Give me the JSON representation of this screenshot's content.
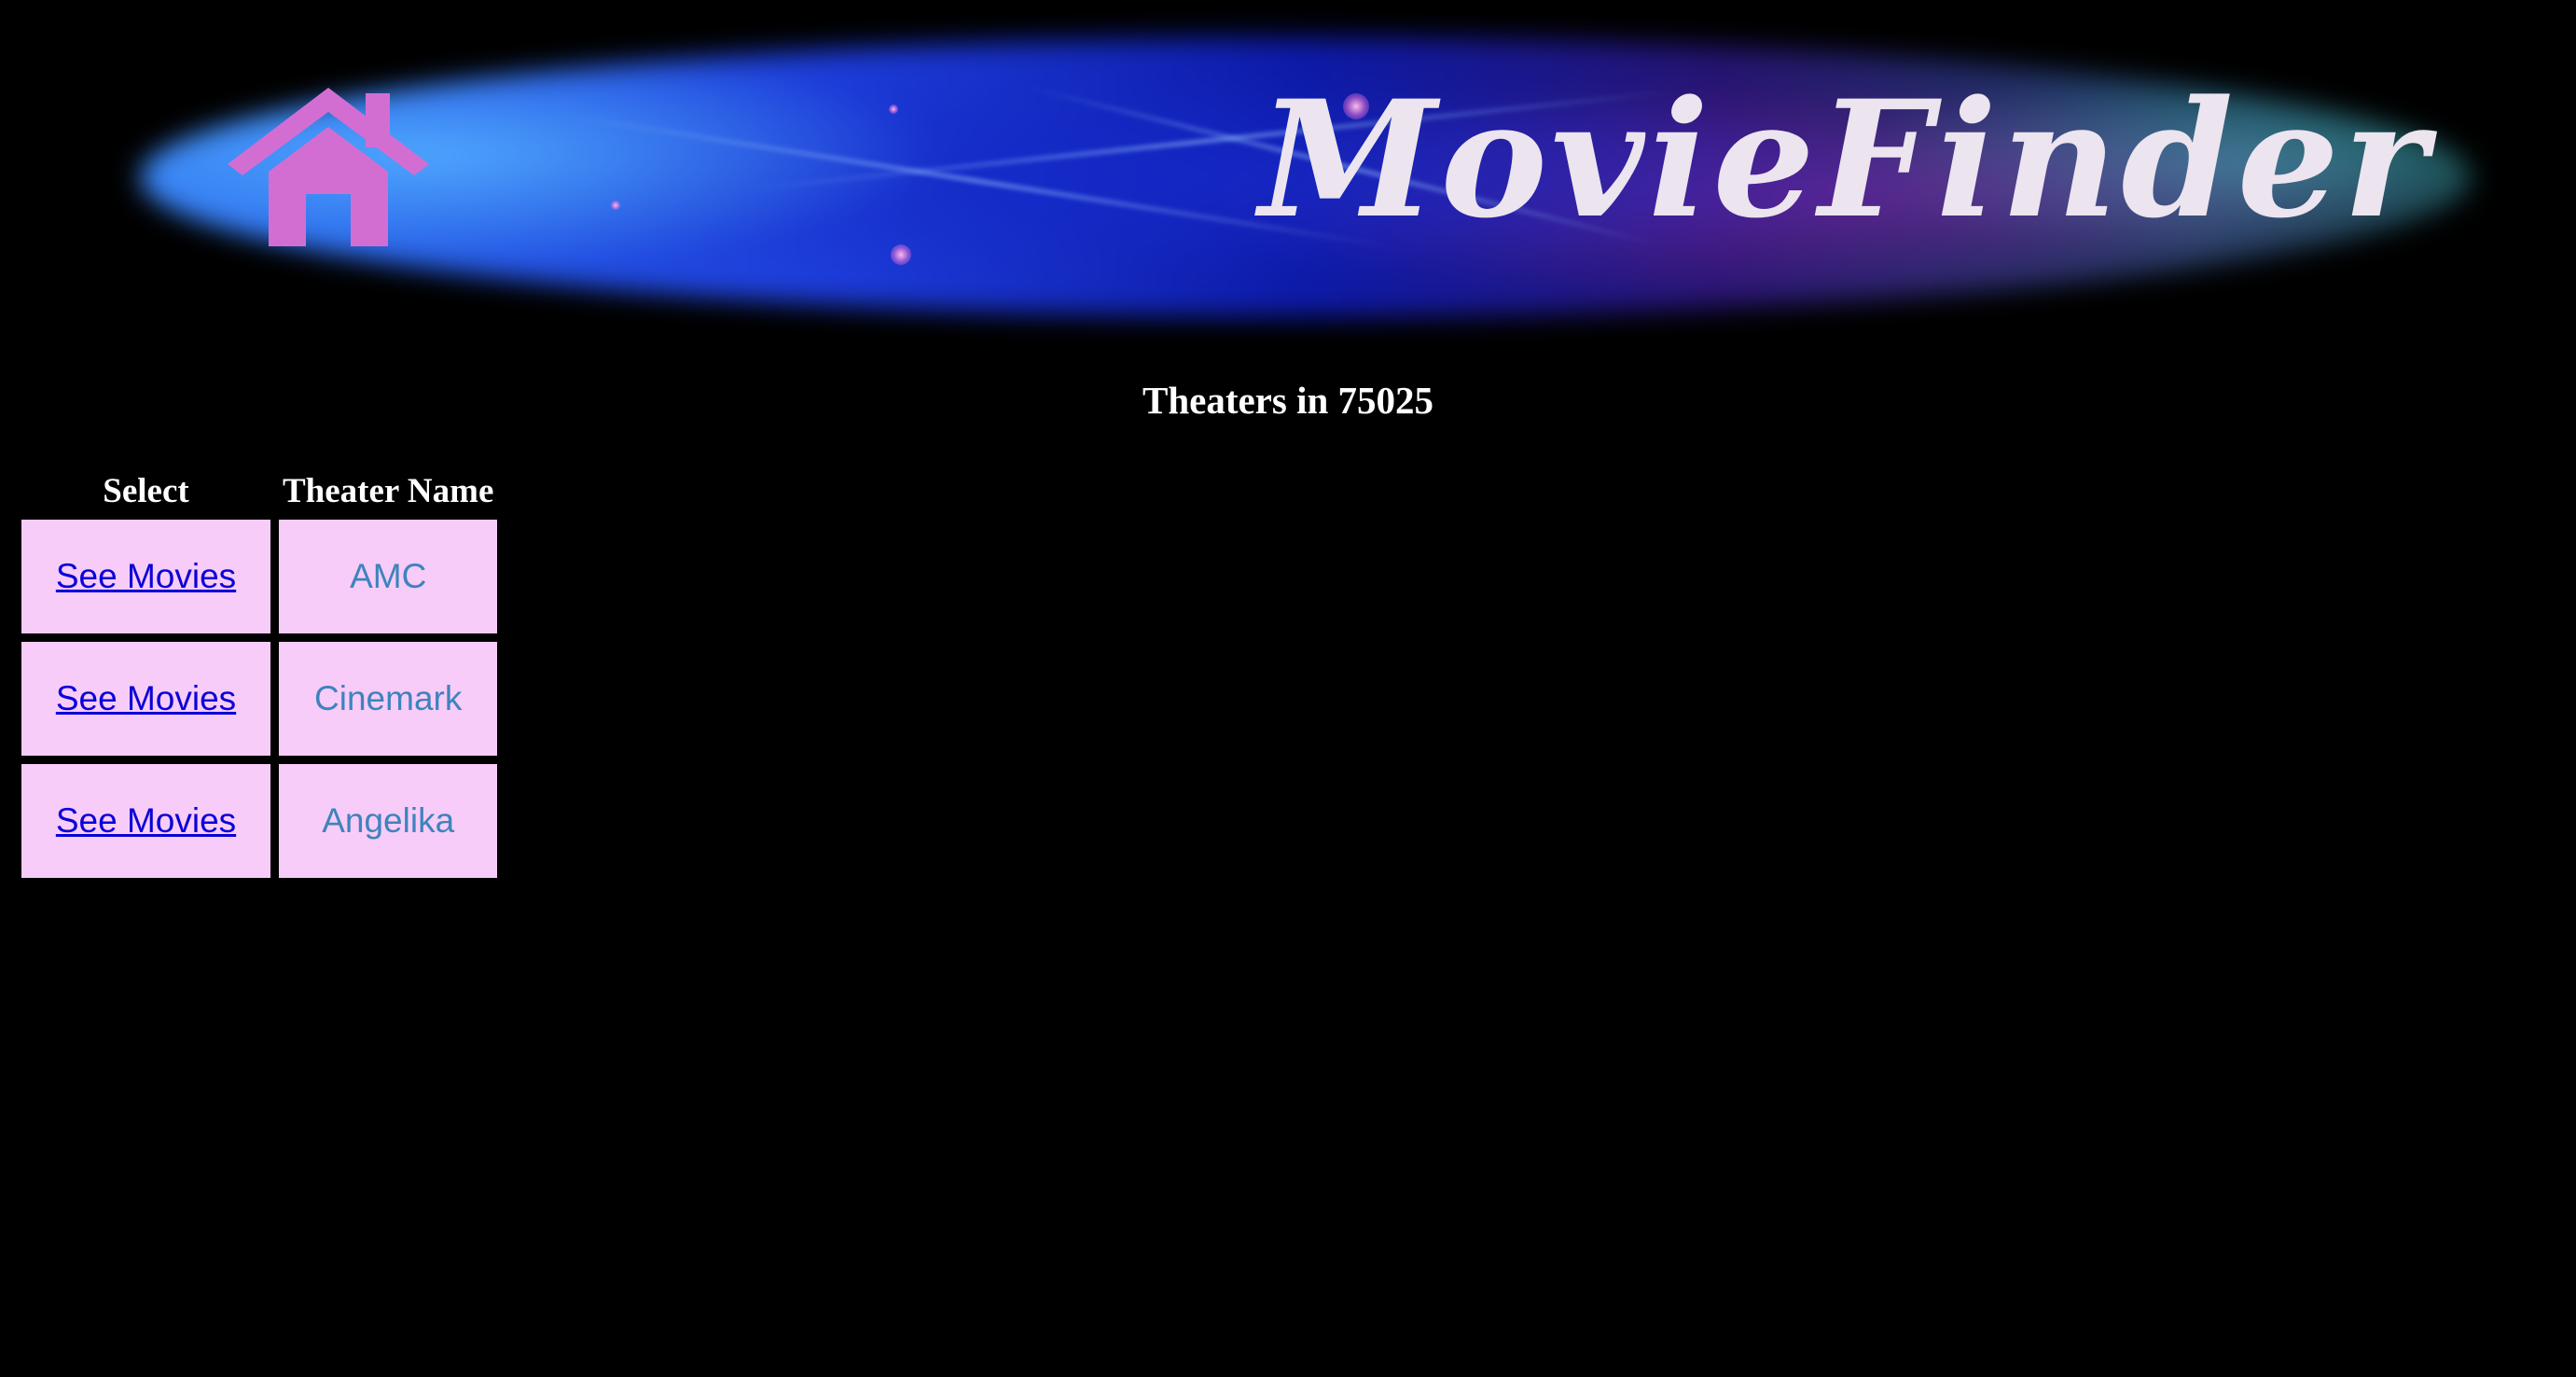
{
  "banner": {
    "brand_name": "MovieFinder",
    "home_icon": "home-icon",
    "colors": {
      "home_icon": "#d26ed2",
      "brand_text": "#ece4ee"
    }
  },
  "page": {
    "title": "Theaters in 75025",
    "background": "#000000"
  },
  "table": {
    "headers": {
      "select": "Select",
      "theater_name": "Theater Name"
    },
    "rows": [
      {
        "link_label": "See Movies",
        "theater_name": "AMC"
      },
      {
        "link_label": "See Movies",
        "theater_name": "Cinemark"
      },
      {
        "link_label": "See Movies",
        "theater_name": "Angelika"
      }
    ],
    "colors": {
      "cell_background": "#f8ccf8",
      "link": "#0a00d8",
      "theater_name": "#3d84bd"
    }
  }
}
